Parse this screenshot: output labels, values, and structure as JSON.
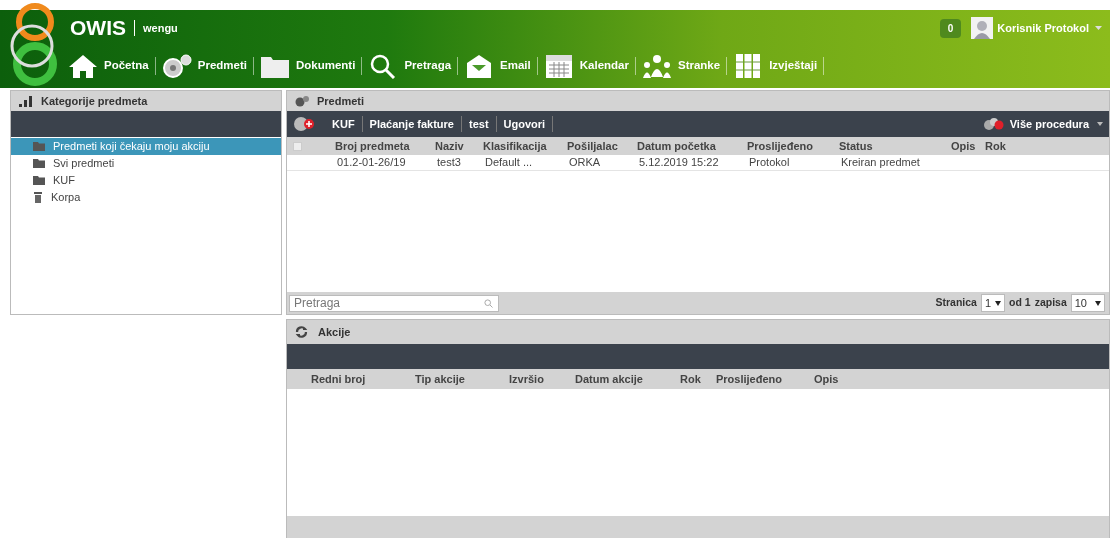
{
  "header": {
    "app_name": "OWIS",
    "workspace": "wengu",
    "notification_count": "0",
    "user_name": "Korisnik Protokol"
  },
  "nav": [
    {
      "label": "Početna",
      "kind": "home"
    },
    {
      "label": "Predmeti",
      "kind": "gears"
    },
    {
      "label": "Dokumenti",
      "kind": "folder"
    },
    {
      "label": "Pretraga",
      "kind": "search"
    },
    {
      "label": "Email",
      "kind": "mail"
    },
    {
      "label": "Kalendar",
      "kind": "calendar"
    },
    {
      "label": "Stranke",
      "kind": "people"
    },
    {
      "label": "Izvještaji",
      "kind": "reports"
    }
  ],
  "categories": {
    "title": "Kategorije predmeta",
    "items": [
      {
        "label": "Predmeti koji čekaju moju akciju",
        "kind": "folder",
        "selected": true
      },
      {
        "label": "Svi predmeti",
        "kind": "folder",
        "selected": false
      },
      {
        "label": "KUF",
        "kind": "folder",
        "selected": false
      },
      {
        "label": "Korpa",
        "kind": "trash",
        "selected": false
      }
    ]
  },
  "cases": {
    "title": "Predmeti",
    "procedures": [
      "KUF",
      "Plaćanje fakture",
      "test",
      "Ugovori"
    ],
    "more_procedures": "Više procedura",
    "select_all_checked": false,
    "columns": [
      "Broj predmeta",
      "Naziv",
      "Klasifikacija",
      "Pošiljalac",
      "Datum početka",
      "Proslijeđeno",
      "Status",
      "Opis",
      "Rok"
    ],
    "rows": [
      {
        "cells": [
          "01.2-01-26/19",
          "test3",
          "Default ...",
          "ORKA",
          "5.12.2019 15:22",
          "Protokol",
          "Kreiran predmet",
          "",
          ""
        ]
      }
    ],
    "search": {
      "placeholder": "Pretraga"
    },
    "pager": {
      "page_label": "Stranica",
      "page": "1",
      "of_label": "od 1",
      "records_label": "zapisa",
      "records": "10"
    }
  },
  "actions": {
    "title": "Akcije",
    "columns": [
      "Redni broj",
      "Tip akcije",
      "Izvršio",
      "Datum akcije",
      "Rok",
      "Proslijeđeno",
      "Opis"
    ]
  }
}
